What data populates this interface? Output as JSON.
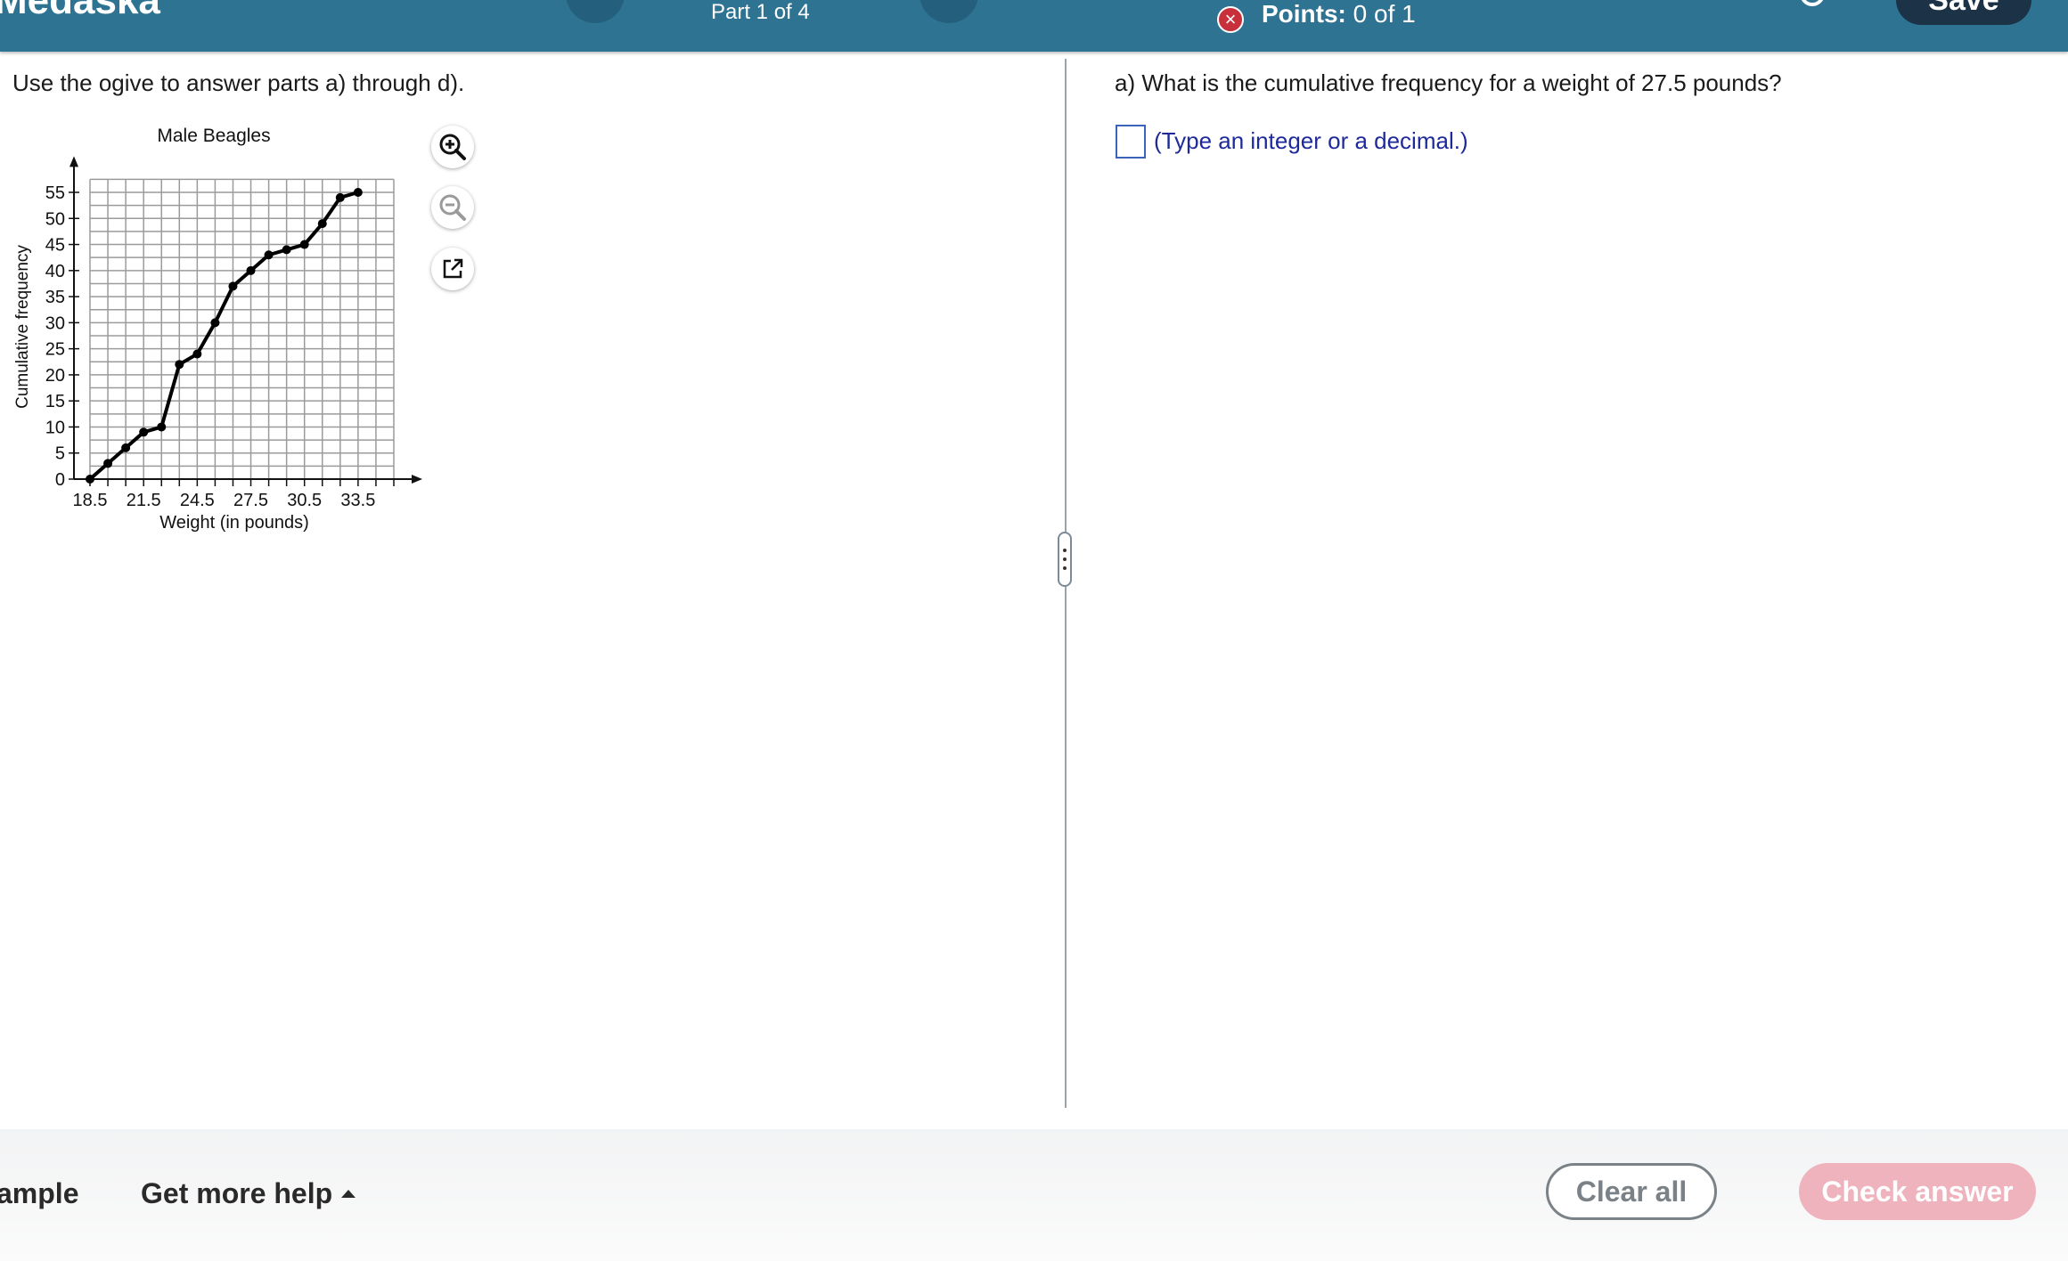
{
  "header": {
    "brand": "Medaska",
    "part_label": "Part 1 of 4",
    "points_label": "Points:",
    "points_value": "0 of 1",
    "save_label": "Save"
  },
  "left": {
    "instructions": "Use the ogive to answer parts a) through d)."
  },
  "chart_data": {
    "type": "line",
    "title": "Male Beagles",
    "xlabel": "Weight (in pounds)",
    "ylabel": "Cumulative frequency",
    "x_tick_labels": [
      "18.5",
      "21.5",
      "24.5",
      "27.5",
      "30.5",
      "33.5"
    ],
    "y_tick_labels": [
      "0",
      "5",
      "10",
      "15",
      "20",
      "25",
      "30",
      "35",
      "40",
      "45",
      "50",
      "55"
    ],
    "xlim": [
      18.5,
      35.5
    ],
    "ylim": [
      0,
      55
    ],
    "grid": true,
    "series": [
      {
        "x": [
          18.5,
          19.5,
          20.5,
          21.5,
          22.5,
          23.5,
          24.5,
          25.5,
          26.5,
          27.5,
          28.5,
          29.5,
          30.5,
          31.5,
          32.5,
          33.5
        ],
        "y": [
          0,
          3,
          6,
          9,
          10,
          22,
          24,
          30,
          37,
          40,
          43,
          44,
          45,
          49,
          54,
          55
        ]
      }
    ]
  },
  "right": {
    "question": "a) What is the cumulative frequency for a weight of 27.5 pounds?",
    "hint": "(Type an integer or a decimal.)",
    "answer_value": ""
  },
  "footer": {
    "example_label": "ample",
    "more_help_label": "Get more help",
    "clear_label": "Clear all",
    "check_label": "Check answer"
  }
}
